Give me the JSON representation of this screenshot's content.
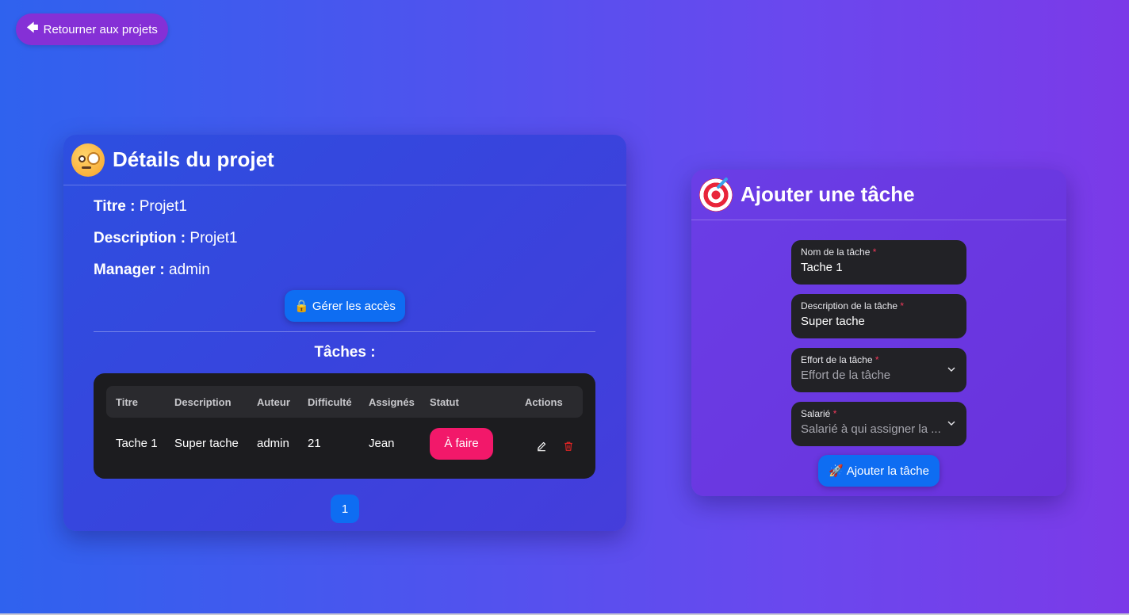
{
  "nav": {
    "back_label": "Retourner aux projets"
  },
  "project": {
    "heading": "Détails du projet",
    "fields": [
      {
        "key": "Titre :",
        "value": "Projet1"
      },
      {
        "key": "Description :",
        "value": "Projet1"
      },
      {
        "key": "Manager :",
        "value": "admin"
      }
    ],
    "access_button": "Gérer les accès",
    "tasks_title": "Tâches :",
    "table": {
      "columns": [
        "Titre",
        "Description",
        "Auteur",
        "Difficulté",
        "Assignés",
        "Statut",
        "Actions"
      ],
      "rows": [
        {
          "title": "Tache 1",
          "description": "Super tache",
          "author": "admin",
          "difficulty": "21",
          "assignees": "Jean",
          "status": "À faire"
        }
      ]
    },
    "pagination": {
      "current_page": "1"
    }
  },
  "task_form": {
    "heading": "Ajouter une tâche",
    "name": {
      "label": "Nom de la tâche",
      "value": "Tache 1"
    },
    "description": {
      "label": "Description de la tâche",
      "value": "Super tache"
    },
    "effort": {
      "label": "Effort de la tâche",
      "placeholder": "Effort de la tâche"
    },
    "employee": {
      "label": "Salarié",
      "placeholder": "Salarié à qui assigner la ..."
    },
    "required_marker": "*",
    "submit_label": "Ajouter la tâche"
  },
  "colors": {
    "accent_blue": "#0e6df2",
    "back_button": "#8530d6",
    "status_todo": "#f2186a",
    "delete_red": "#e02424"
  }
}
